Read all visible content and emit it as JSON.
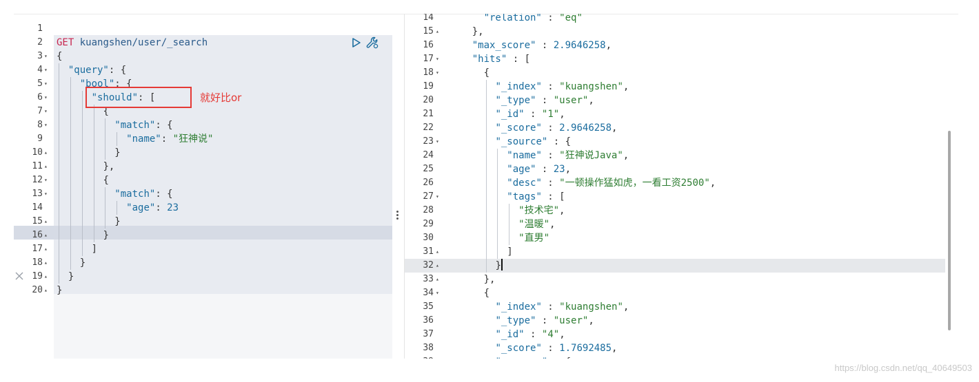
{
  "request": {
    "method": "GET",
    "path": "kuangshen/user/_search",
    "lines": [
      {
        "n": "1",
        "fold": "",
        "indent": 0,
        "tokens": []
      },
      {
        "n": "2",
        "fold": "",
        "indent": 0,
        "tokens": [
          {
            "c": "t-method",
            "t": "GET"
          },
          {
            "c": "t-punc",
            "t": " "
          },
          {
            "c": "t-path",
            "t": "kuangshen/user/_search"
          }
        ]
      },
      {
        "n": "3",
        "fold": "▾",
        "indent": 0,
        "tokens": [
          {
            "c": "t-punc",
            "t": "{"
          }
        ]
      },
      {
        "n": "4",
        "fold": "▾",
        "indent": 1,
        "tokens": [
          {
            "c": "t-key",
            "t": "\"query\""
          },
          {
            "c": "t-punc",
            "t": ": {"
          }
        ]
      },
      {
        "n": "5",
        "fold": "▾",
        "indent": 2,
        "tokens": [
          {
            "c": "t-key",
            "t": "\"bool\""
          },
          {
            "c": "t-punc",
            "t": ": {"
          }
        ]
      },
      {
        "n": "6",
        "fold": "▾",
        "indent": 3,
        "tokens": [
          {
            "c": "t-key",
            "t": "\"should\""
          },
          {
            "c": "t-punc",
            "t": ": ["
          }
        ]
      },
      {
        "n": "7",
        "fold": "▾",
        "indent": 4,
        "tokens": [
          {
            "c": "t-punc",
            "t": "{"
          }
        ]
      },
      {
        "n": "8",
        "fold": "▾",
        "indent": 5,
        "tokens": [
          {
            "c": "t-key",
            "t": "\"match\""
          },
          {
            "c": "t-punc",
            "t": ": {"
          }
        ]
      },
      {
        "n": "9",
        "fold": "",
        "indent": 6,
        "tokens": [
          {
            "c": "t-key",
            "t": "\"name\""
          },
          {
            "c": "t-punc",
            "t": ": "
          },
          {
            "c": "t-str",
            "t": "\"狂神说\""
          }
        ]
      },
      {
        "n": "10",
        "fold": "▴",
        "indent": 5,
        "tokens": [
          {
            "c": "t-punc",
            "t": "}"
          }
        ]
      },
      {
        "n": "11",
        "fold": "▴",
        "indent": 4,
        "tokens": [
          {
            "c": "t-punc",
            "t": "},"
          }
        ]
      },
      {
        "n": "12",
        "fold": "▾",
        "indent": 4,
        "tokens": [
          {
            "c": "t-punc",
            "t": "{"
          }
        ]
      },
      {
        "n": "13",
        "fold": "▾",
        "indent": 5,
        "tokens": [
          {
            "c": "t-key",
            "t": "\"match\""
          },
          {
            "c": "t-punc",
            "t": ": {"
          }
        ]
      },
      {
        "n": "14",
        "fold": "",
        "indent": 6,
        "tokens": [
          {
            "c": "t-key",
            "t": "\"age\""
          },
          {
            "c": "t-punc",
            "t": ": "
          },
          {
            "c": "t-num",
            "t": "23"
          }
        ]
      },
      {
        "n": "15",
        "fold": "▴",
        "indent": 5,
        "tokens": [
          {
            "c": "t-punc",
            "t": "}"
          }
        ]
      },
      {
        "n": "16",
        "fold": "▴",
        "indent": 4,
        "tokens": [
          {
            "c": "t-punc",
            "t": "}"
          }
        ]
      },
      {
        "n": "17",
        "fold": "▴",
        "indent": 3,
        "tokens": [
          {
            "c": "t-punc",
            "t": "]"
          }
        ]
      },
      {
        "n": "18",
        "fold": "▴",
        "indent": 2,
        "tokens": [
          {
            "c": "t-punc",
            "t": "}"
          }
        ]
      },
      {
        "n": "19",
        "fold": "▴",
        "indent": 1,
        "tokens": [
          {
            "c": "t-punc",
            "t": "}"
          }
        ]
      },
      {
        "n": "20",
        "fold": "▴",
        "indent": 0,
        "tokens": [
          {
            "c": "t-punc",
            "t": "}"
          }
        ]
      }
    ]
  },
  "annotation": {
    "text": "就好比or"
  },
  "response": {
    "lines": [
      {
        "n": "14",
        "fold": "",
        "indent": 3,
        "tokens": [
          {
            "c": "t-key",
            "t": "\"relation\""
          },
          {
            "c": "t-punc",
            "t": " : "
          },
          {
            "c": "t-str",
            "t": "\"eq\""
          }
        ]
      },
      {
        "n": "15",
        "fold": "▴",
        "indent": 2,
        "tokens": [
          {
            "c": "t-punc",
            "t": "},"
          }
        ]
      },
      {
        "n": "16",
        "fold": "",
        "indent": 2,
        "tokens": [
          {
            "c": "t-key",
            "t": "\"max_score\""
          },
          {
            "c": "t-punc",
            "t": " : "
          },
          {
            "c": "t-num",
            "t": "2.9646258"
          },
          {
            "c": "t-punc",
            "t": ","
          }
        ]
      },
      {
        "n": "17",
        "fold": "▾",
        "indent": 2,
        "tokens": [
          {
            "c": "t-key",
            "t": "\"hits\""
          },
          {
            "c": "t-punc",
            "t": " : ["
          }
        ]
      },
      {
        "n": "18",
        "fold": "▾",
        "indent": 3,
        "tokens": [
          {
            "c": "t-punc",
            "t": "{"
          }
        ]
      },
      {
        "n": "19",
        "fold": "",
        "indent": 4,
        "tokens": [
          {
            "c": "t-key",
            "t": "\"_index\""
          },
          {
            "c": "t-punc",
            "t": " : "
          },
          {
            "c": "t-str",
            "t": "\"kuangshen\""
          },
          {
            "c": "t-punc",
            "t": ","
          }
        ]
      },
      {
        "n": "20",
        "fold": "",
        "indent": 4,
        "tokens": [
          {
            "c": "t-key",
            "t": "\"_type\""
          },
          {
            "c": "t-punc",
            "t": " : "
          },
          {
            "c": "t-str",
            "t": "\"user\""
          },
          {
            "c": "t-punc",
            "t": ","
          }
        ]
      },
      {
        "n": "21",
        "fold": "",
        "indent": 4,
        "tokens": [
          {
            "c": "t-key",
            "t": "\"_id\""
          },
          {
            "c": "t-punc",
            "t": " : "
          },
          {
            "c": "t-str",
            "t": "\"1\""
          },
          {
            "c": "t-punc",
            "t": ","
          }
        ]
      },
      {
        "n": "22",
        "fold": "",
        "indent": 4,
        "tokens": [
          {
            "c": "t-key",
            "t": "\"_score\""
          },
          {
            "c": "t-punc",
            "t": " : "
          },
          {
            "c": "t-num",
            "t": "2.9646258"
          },
          {
            "c": "t-punc",
            "t": ","
          }
        ]
      },
      {
        "n": "23",
        "fold": "▾",
        "indent": 4,
        "tokens": [
          {
            "c": "t-key",
            "t": "\"_source\""
          },
          {
            "c": "t-punc",
            "t": " : {"
          }
        ]
      },
      {
        "n": "24",
        "fold": "",
        "indent": 5,
        "tokens": [
          {
            "c": "t-key",
            "t": "\"name\""
          },
          {
            "c": "t-punc",
            "t": " : "
          },
          {
            "c": "t-str",
            "t": "\"狂神说Java\""
          },
          {
            "c": "t-punc",
            "t": ","
          }
        ]
      },
      {
        "n": "25",
        "fold": "",
        "indent": 5,
        "tokens": [
          {
            "c": "t-key",
            "t": "\"age\""
          },
          {
            "c": "t-punc",
            "t": " : "
          },
          {
            "c": "t-num",
            "t": "23"
          },
          {
            "c": "t-punc",
            "t": ","
          }
        ]
      },
      {
        "n": "26",
        "fold": "",
        "indent": 5,
        "tokens": [
          {
            "c": "t-key",
            "t": "\"desc\""
          },
          {
            "c": "t-punc",
            "t": " : "
          },
          {
            "c": "t-str",
            "t": "\"一顿操作猛如虎，一看工资2500\""
          },
          {
            "c": "t-punc",
            "t": ","
          }
        ]
      },
      {
        "n": "27",
        "fold": "▾",
        "indent": 5,
        "tokens": [
          {
            "c": "t-key",
            "t": "\"tags\""
          },
          {
            "c": "t-punc",
            "t": " : ["
          }
        ]
      },
      {
        "n": "28",
        "fold": "",
        "indent": 6,
        "tokens": [
          {
            "c": "t-str",
            "t": "\"技术宅\""
          },
          {
            "c": "t-punc",
            "t": ","
          }
        ]
      },
      {
        "n": "29",
        "fold": "",
        "indent": 6,
        "tokens": [
          {
            "c": "t-str",
            "t": "\"温暖\""
          },
          {
            "c": "t-punc",
            "t": ","
          }
        ]
      },
      {
        "n": "30",
        "fold": "",
        "indent": 6,
        "tokens": [
          {
            "c": "t-str",
            "t": "\"直男\""
          }
        ]
      },
      {
        "n": "31",
        "fold": "▴",
        "indent": 5,
        "tokens": [
          {
            "c": "t-punc",
            "t": "]"
          }
        ]
      },
      {
        "n": "32",
        "fold": "▴",
        "indent": 4,
        "tokens": [
          {
            "c": "t-punc",
            "t": "}"
          }
        ],
        "cursor": true
      },
      {
        "n": "33",
        "fold": "▴",
        "indent": 3,
        "tokens": [
          {
            "c": "t-punc",
            "t": "},"
          }
        ]
      },
      {
        "n": "34",
        "fold": "▾",
        "indent": 3,
        "tokens": [
          {
            "c": "t-punc",
            "t": "{"
          }
        ]
      },
      {
        "n": "35",
        "fold": "",
        "indent": 4,
        "tokens": [
          {
            "c": "t-key",
            "t": "\"_index\""
          },
          {
            "c": "t-punc",
            "t": " : "
          },
          {
            "c": "t-str",
            "t": "\"kuangshen\""
          },
          {
            "c": "t-punc",
            "t": ","
          }
        ]
      },
      {
        "n": "36",
        "fold": "",
        "indent": 4,
        "tokens": [
          {
            "c": "t-key",
            "t": "\"_type\""
          },
          {
            "c": "t-punc",
            "t": " : "
          },
          {
            "c": "t-str",
            "t": "\"user\""
          },
          {
            "c": "t-punc",
            "t": ","
          }
        ]
      },
      {
        "n": "37",
        "fold": "",
        "indent": 4,
        "tokens": [
          {
            "c": "t-key",
            "t": "\"_id\""
          },
          {
            "c": "t-punc",
            "t": " : "
          },
          {
            "c": "t-str",
            "t": "\"4\""
          },
          {
            "c": "t-punc",
            "t": ","
          }
        ]
      },
      {
        "n": "38",
        "fold": "",
        "indent": 4,
        "tokens": [
          {
            "c": "t-key",
            "t": "\"_score\""
          },
          {
            "c": "t-punc",
            "t": " : "
          },
          {
            "c": "t-num",
            "t": "1.7692485"
          },
          {
            "c": "t-punc",
            "t": ","
          }
        ]
      },
      {
        "n": "39",
        "fold": "▾",
        "indent": 4,
        "tokens": [
          {
            "c": "t-key",
            "t": "\"_source\""
          },
          {
            "c": "t-punc",
            "t": " : {"
          }
        ]
      }
    ]
  },
  "icons": {
    "run": "play-icon",
    "settings": "wrench-icon",
    "close": "close-icon",
    "splitter": "drag-handle-icon"
  },
  "watermark": "https://blog.csdn.net/qq_40649503"
}
